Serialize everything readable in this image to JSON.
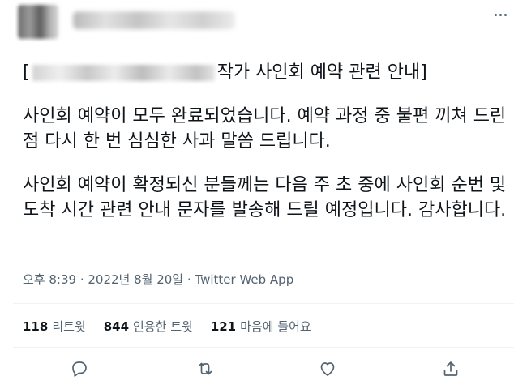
{
  "tweet": {
    "title_open": "[",
    "title_suffix": "작가 사인회 예약 관련 안내]",
    "paragraph1": "사인회 예약이 모두 완료되었습니다. 예약 과정 중 불편 끼쳐 드린 점 다시 한 번 심심한 사과 말씀 드립니다.",
    "paragraph2": "사인회 예약이 확정되신 분들께는 다음 주 초 중에 사인회 순번 및 도착 시간 관련 안내 문자를 발송해 드릴 예정입니다. 감사합니다.",
    "timestamp": "오후 8:39 · 2022년 8월 20일 · Twitter Web App"
  },
  "stats": {
    "retweets_count": "118",
    "retweets_label": "리트윗",
    "quotes_count": "844",
    "quotes_label": "인용한 트윗",
    "likes_count": "121",
    "likes_label": "마음에 들어요"
  },
  "icons": {
    "more": "more-dots-icon",
    "reply": "reply-icon",
    "retweet": "retweet-icon",
    "like": "heart-icon",
    "share": "share-icon"
  },
  "colors": {
    "text": "#0f1419",
    "secondary": "#536471",
    "divider": "#eff3f4"
  }
}
